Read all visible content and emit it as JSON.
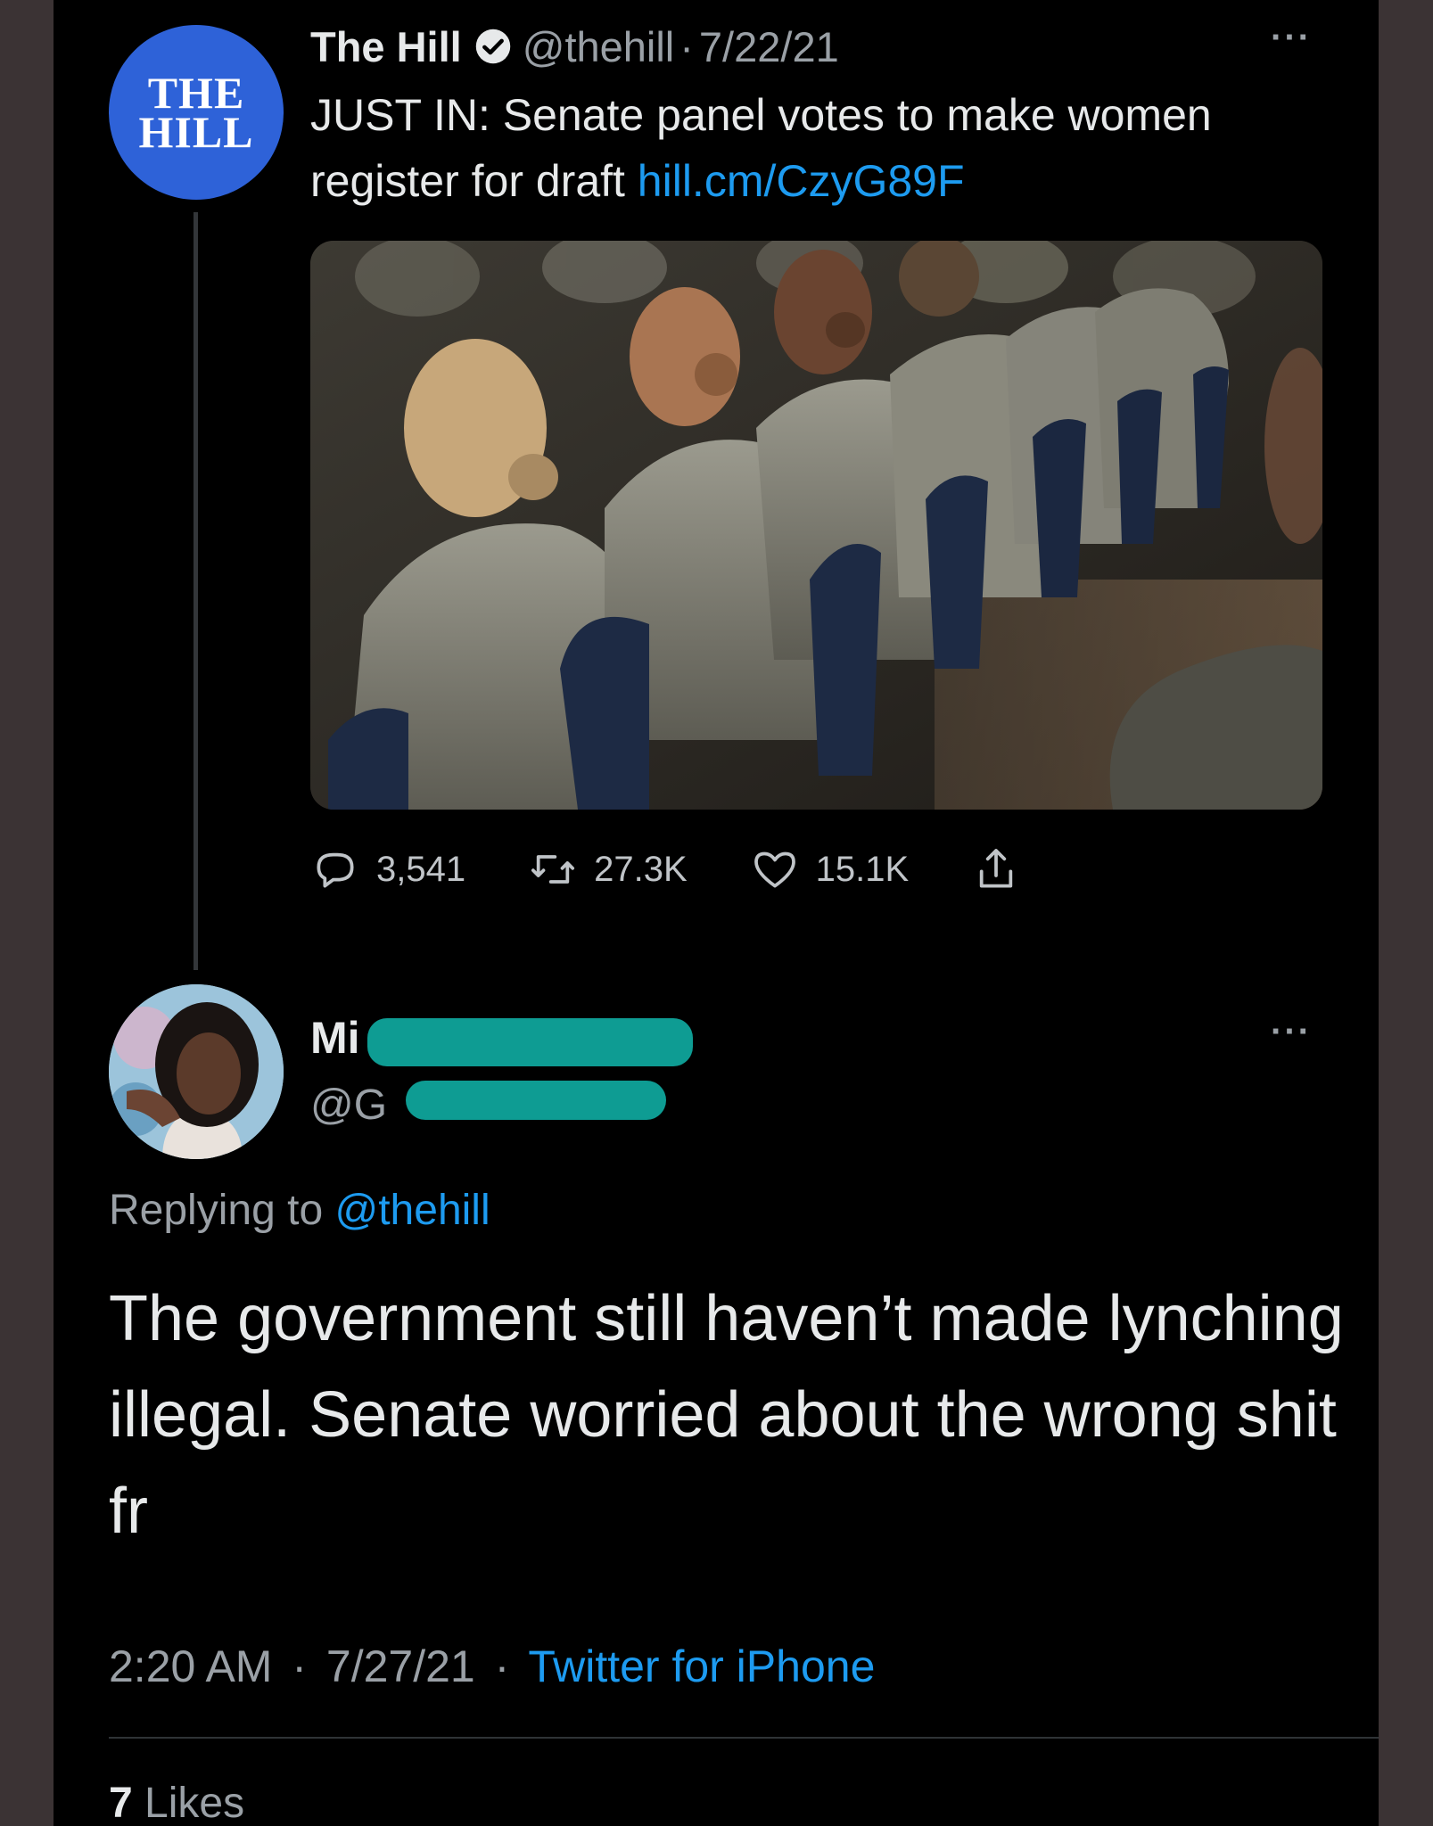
{
  "quoted_tweet": {
    "avatar_text_line1": "THE",
    "avatar_text_line2": "HILL",
    "name": "The Hill",
    "handle": "@thehill",
    "separator": "·",
    "date": "7/22/21",
    "more": "···",
    "text": "JUST IN: Senate panel votes to make women register for draft ",
    "link": "hill.cm/CzyG89F",
    "stats": {
      "replies": "3,541",
      "retweets": "27.3K",
      "likes": "15.1K"
    }
  },
  "reply_tweet": {
    "name_visible": "Mi",
    "handle_visible": "@G",
    "more": "···",
    "replying_prefix": "Replying to ",
    "replying_handle": "@thehill",
    "text": "The government still haven’t made lynching illegal. Senate worried about the wrong shit fr",
    "time": "2:20 AM",
    "separator": "·",
    "date": "7/27/21",
    "source": "Twitter for iPhone",
    "likes_count": "7",
    "likes_label": "Likes"
  },
  "colors": {
    "background": "#000000",
    "text": "#e7e9ea",
    "secondary": "#9aa0a6",
    "link": "#1d9bf0",
    "redaction": "#0e9c93",
    "hill_blue": "#2e62d8"
  }
}
